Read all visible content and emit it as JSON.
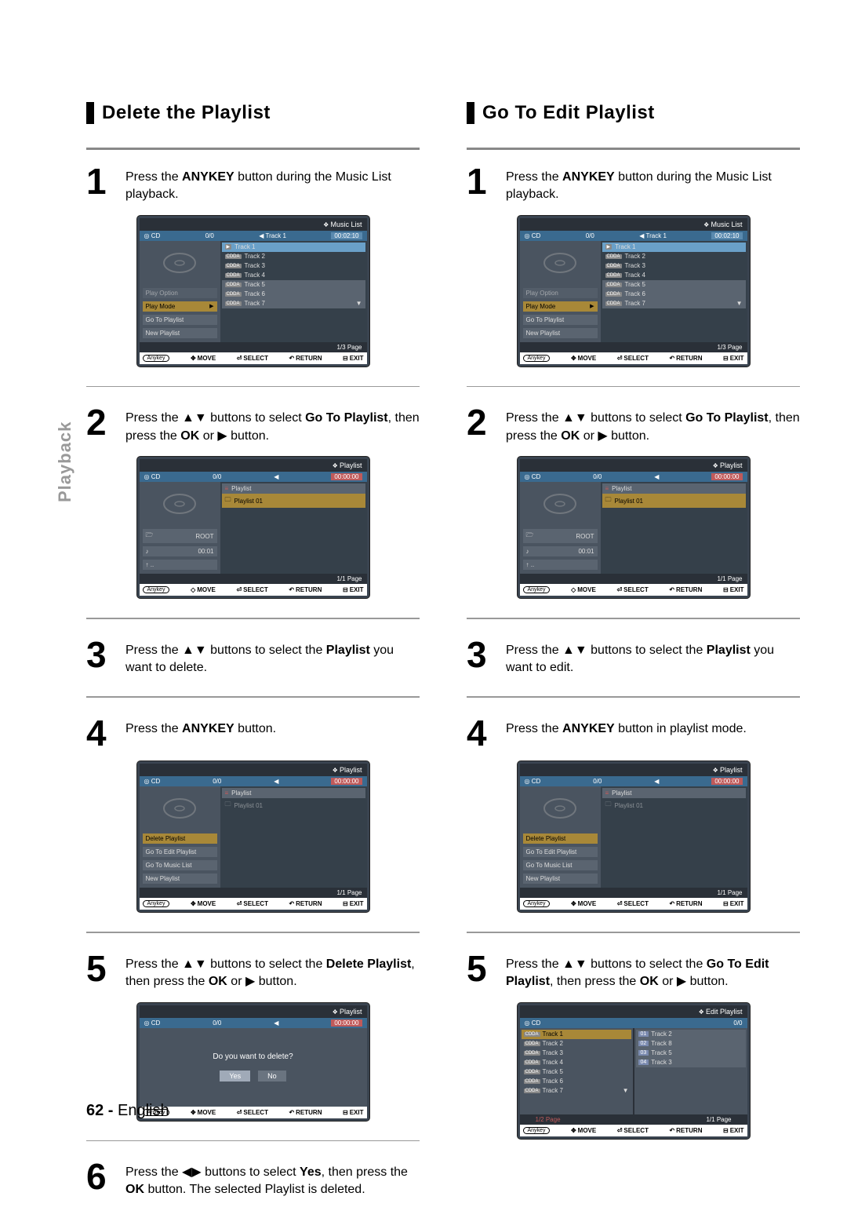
{
  "page": {
    "number": "62 -",
    "lang": "English",
    "sidebar": "Playback"
  },
  "left": {
    "title": "Delete the Playlist",
    "s1": {
      "pre": "Press the ",
      "b1": "ANYKEY",
      "post": " button during the Music List playback."
    },
    "s2": {
      "pre": "Press the ▲▼ buttons to select ",
      "b1": "Go To Playlist",
      "mid": ", then press the ",
      "b2": "OK",
      "post": " or ▶ button."
    },
    "s3": {
      "pre": "Press the ▲▼ buttons to select the ",
      "b1": "Playlist",
      "post": " you want to delete."
    },
    "s4": {
      "pre": "Press the ",
      "b1": "ANYKEY",
      "post": " button."
    },
    "s5": {
      "pre": "Press the ▲▼ buttons to select the ",
      "b1": "Delete Playlist",
      "mid": ", then press the ",
      "b2": "OK",
      "post": " or ▶ button."
    },
    "s6": {
      "pre": "Press the ◀▶ buttons to select ",
      "b1": "Yes",
      "mid": ", then press the ",
      "b2": "OK",
      "post": " button. The selected Playlist is deleted."
    }
  },
  "right": {
    "title": "Go To Edit Playlist",
    "s1": {
      "pre": "Press the ",
      "b1": "ANYKEY",
      "post": " button during the Music List playback."
    },
    "s2": {
      "pre": "Press the ▲▼ buttons to select ",
      "b1": "Go To Playlist",
      "mid": ", then press the ",
      "b2": "OK",
      "post": " or ▶ button."
    },
    "s3": {
      "pre": "Press the ▲▼ buttons to select the ",
      "b1": "Playlist",
      "post": " you want to edit."
    },
    "s4": {
      "pre": "Press the ",
      "b1": "ANYKEY",
      "post": " button in playlist mode."
    },
    "s5": {
      "pre": "Press the ▲▼ buttons to select the ",
      "b1": "Go To Edit Playlist",
      "mid": ", then press the ",
      "b2": "OK",
      "post": " or ▶ button."
    }
  },
  "ui": {
    "anykey": "Anykey",
    "foot": {
      "move": "MOVE",
      "select": "SELECT",
      "return": "RETURN",
      "exit": "EXIT"
    },
    "musiclist": {
      "title": "Music List",
      "source": "◎ CD",
      "counter": "0/0",
      "playing": "Track 1",
      "time": "00:02:10",
      "menu": [
        "Play Mode",
        "Go To Playlist",
        "New Playlist"
      ],
      "menu_dim": "Play Option",
      "tracks": [
        "Track 1",
        "Track 2",
        "Track 3",
        "Track 4",
        "Track 5",
        "Track 6",
        "Track 7"
      ],
      "badge": "CDDA",
      "page": "1/3 Page"
    },
    "playlist": {
      "title": "Playlist",
      "source": "◎ CD",
      "counter": "0/0",
      "time": "00:00:00",
      "nav_root": "ROOT",
      "nav_time": "00:01",
      "head": "Playlist",
      "item": "Playlist 01",
      "page": "1/1 Page"
    },
    "playlistmenu": {
      "title": "Playlist",
      "source": "◎ CD",
      "counter": "0/0",
      "time": "00:00:00",
      "menu": [
        "Delete Playlist",
        "Go To Edit Playlist",
        "Go To Music List",
        "New Playlist"
      ],
      "head": "Playlist",
      "item": "Playlist 01",
      "page": "1/1 Page"
    },
    "dialog": {
      "title": "Playlist",
      "source": "◎ CD",
      "counter": "0/0",
      "time": "00:00:00",
      "q": "Do you want to delete?",
      "yes": "Yes",
      "no": "No"
    },
    "edit": {
      "title": "Edit Playlist",
      "source": "◎ CD",
      "counter": "0/0",
      "src_tracks": [
        "Track 1",
        "Track 2",
        "Track 3",
        "Track 4",
        "Track 5",
        "Track 6",
        "Track 7"
      ],
      "dst_tracks": [
        {
          "n": "01",
          "t": "Track 2"
        },
        {
          "n": "02",
          "t": "Track 8"
        },
        {
          "n": "03",
          "t": "Track 5"
        },
        {
          "n": "04",
          "t": "Track 3"
        }
      ],
      "badge": "CDDA",
      "page_l": "1/2 Page",
      "page_r": "1/1 Page"
    }
  }
}
